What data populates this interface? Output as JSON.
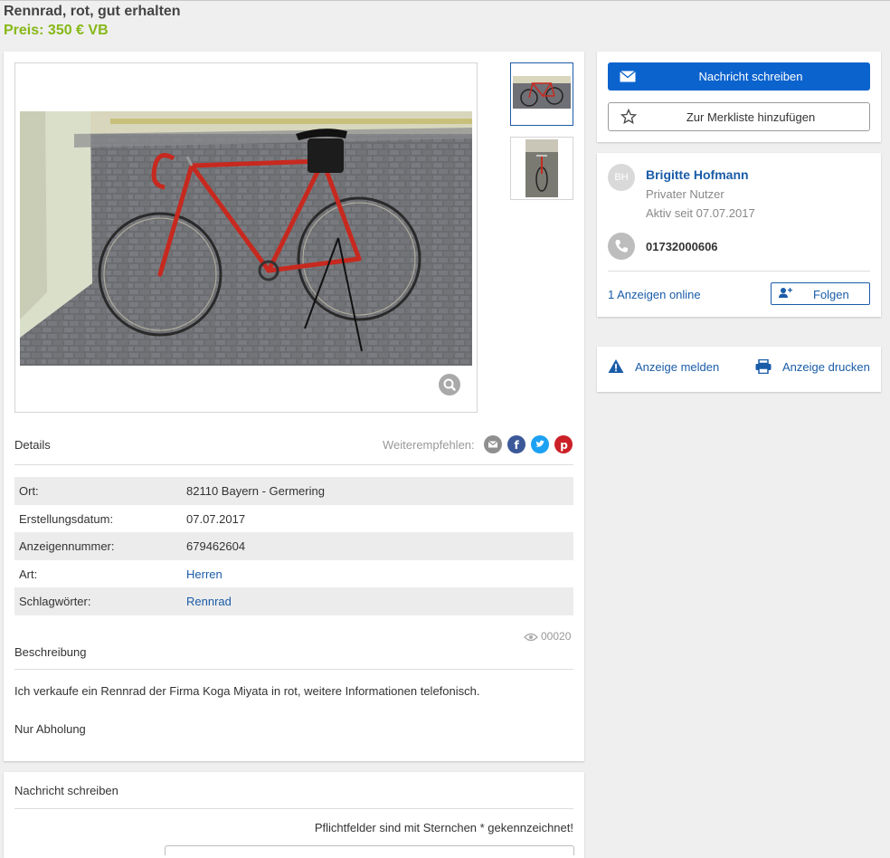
{
  "header": {
    "title": "Rennrad, rot, gut erhalten",
    "price": "Preis: 350 € VB"
  },
  "gallery": {
    "zoom_icon": "magnifier-icon",
    "thumbnail_count": 2
  },
  "details": {
    "heading": "Details",
    "share_label": "Weiterempfehlen:",
    "share_icons": [
      "mail-icon",
      "facebook-icon",
      "twitter-icon",
      "pinterest-icon"
    ],
    "rows": [
      {
        "key": "Ort:",
        "value": "82110 Bayern - Germering",
        "link": false
      },
      {
        "key": "Erstellungsdatum:",
        "value": "07.07.2017",
        "link": false
      },
      {
        "key": "Anzeigennummer:",
        "value": "679462604",
        "link": false
      },
      {
        "key": "Art:",
        "value": "Herren",
        "link": true
      },
      {
        "key": "Schlagwörter:",
        "value": "Rennrad",
        "link": true
      }
    ],
    "views": "00020"
  },
  "description": {
    "heading": "Beschreibung",
    "text": "Ich verkaufe ein Rennrad der Firma Koga Miyata in rot, weitere Informationen telefonisch.",
    "note": "Nur Abholung"
  },
  "contact_form": {
    "heading": "Nachricht schreiben",
    "required_note": "Pflichtfelder sind mit Sternchen * gekennzeichnet!"
  },
  "actions": {
    "message_button": "Nachricht schreiben",
    "watchlist_button": "Zur Merkliste hinzufügen",
    "report": "Anzeige melden",
    "print": "Anzeige drucken"
  },
  "seller": {
    "initials": "BH",
    "name": "Brigitte Hofmann",
    "type": "Privater Nutzer",
    "active_since": "Aktiv seit 07.07.2017",
    "phone": "01732000606",
    "ads_online": "1 Anzeigen online",
    "follow_button": "Folgen"
  },
  "colors": {
    "accent": "#0b63ce",
    "price": "#86b817",
    "link": "#1a5ca8"
  }
}
